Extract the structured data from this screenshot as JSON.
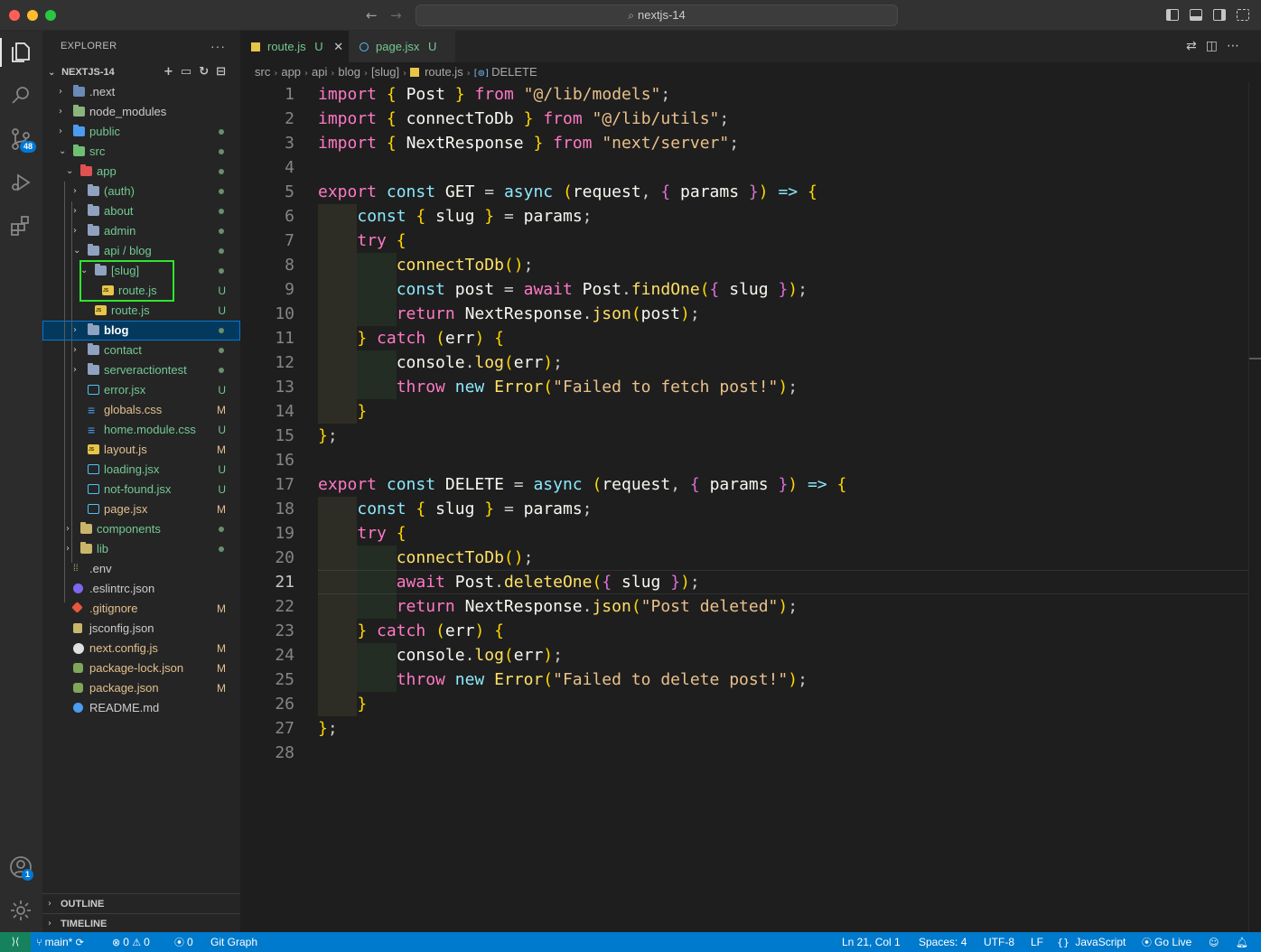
{
  "window": {
    "search_text": "nextjs-14"
  },
  "sidebar": {
    "title": "EXPLORER",
    "more": "···",
    "project": "NEXTJS-14",
    "tree": [
      {
        "name": ".next",
        "type": "folder",
        "depth": 0,
        "chevron": "right",
        "status": "",
        "icon_color": "#6a8bb5"
      },
      {
        "name": "node_modules",
        "type": "folder",
        "depth": 0,
        "chevron": "right",
        "status": "",
        "icon_color": "#8bb57a"
      },
      {
        "name": "public",
        "type": "folder",
        "depth": 0,
        "chevron": "right",
        "status": "dot",
        "icon_color": "#4a9df0"
      },
      {
        "name": "src",
        "type": "folder",
        "depth": 0,
        "chevron": "down",
        "status": "dot",
        "icon_color": "#6fbf73"
      },
      {
        "name": "app",
        "type": "folder",
        "depth": 1,
        "chevron": "down",
        "status": "dot",
        "icon_color": "#e05252"
      },
      {
        "name": "(auth)",
        "type": "folder",
        "depth": 2,
        "chevron": "right",
        "status": "dot",
        "icon_color": "#8fa3c0"
      },
      {
        "name": "about",
        "type": "folder",
        "depth": 2,
        "chevron": "right",
        "status": "dot",
        "icon_color": "#8fa3c0"
      },
      {
        "name": "admin",
        "type": "folder",
        "depth": 2,
        "chevron": "right",
        "status": "dot",
        "icon_color": "#8fa3c0"
      },
      {
        "name": "api / blog",
        "type": "folder",
        "depth": 2,
        "chevron": "down",
        "status": "dot",
        "icon_color": "#8fa3c0"
      },
      {
        "name": "[slug]",
        "type": "folder",
        "depth": 3,
        "chevron": "down",
        "status": "dot",
        "icon_color": "#8fa3c0"
      },
      {
        "name": "route.js",
        "type": "js",
        "depth": 4,
        "chevron": "",
        "status": "U"
      },
      {
        "name": "route.js",
        "type": "js",
        "depth": 3,
        "chevron": "",
        "status": "U"
      },
      {
        "name": "blog",
        "type": "folder",
        "depth": 2,
        "chevron": "right",
        "status": "dot",
        "selected": true,
        "icon_color": "#8fa3c0"
      },
      {
        "name": "contact",
        "type": "folder",
        "depth": 2,
        "chevron": "right",
        "status": "dot",
        "icon_color": "#8fa3c0"
      },
      {
        "name": "serveractiontest",
        "type": "folder",
        "depth": 2,
        "chevron": "right",
        "status": "dot",
        "icon_color": "#8fa3c0"
      },
      {
        "name": "error.jsx",
        "type": "react",
        "depth": 2,
        "chevron": "",
        "status": "U"
      },
      {
        "name": "globals.css",
        "type": "css",
        "depth": 2,
        "chevron": "",
        "status": "M"
      },
      {
        "name": "home.module.css",
        "type": "css",
        "depth": 2,
        "chevron": "",
        "status": "U"
      },
      {
        "name": "layout.js",
        "type": "js",
        "depth": 2,
        "chevron": "",
        "status": "M"
      },
      {
        "name": "loading.jsx",
        "type": "react",
        "depth": 2,
        "chevron": "",
        "status": "U"
      },
      {
        "name": "not-found.jsx",
        "type": "react",
        "depth": 2,
        "chevron": "",
        "status": "U"
      },
      {
        "name": "page.jsx",
        "type": "react",
        "depth": 2,
        "chevron": "",
        "status": "M"
      },
      {
        "name": "components",
        "type": "folder",
        "depth": 1,
        "chevron": "right",
        "status": "dot",
        "icon_color": "#c9b66a"
      },
      {
        "name": "lib",
        "type": "folder",
        "depth": 1,
        "chevron": "right",
        "status": "dot",
        "icon_color": "#c9b66a"
      },
      {
        "name": ".env",
        "type": "env",
        "depth": 0,
        "chevron": "",
        "status": ""
      },
      {
        "name": ".eslintrc.json",
        "type": "eslint",
        "depth": 0,
        "chevron": "",
        "status": ""
      },
      {
        "name": ".gitignore",
        "type": "git",
        "depth": 0,
        "chevron": "",
        "status": "M"
      },
      {
        "name": "jsconfig.json",
        "type": "json",
        "depth": 0,
        "chevron": "",
        "status": ""
      },
      {
        "name": "next.config.js",
        "type": "next",
        "depth": 0,
        "chevron": "",
        "status": "M"
      },
      {
        "name": "package-lock.json",
        "type": "pkg",
        "depth": 0,
        "chevron": "",
        "status": "M"
      },
      {
        "name": "package.json",
        "type": "pkg",
        "depth": 0,
        "chevron": "",
        "status": "M"
      },
      {
        "name": "README.md",
        "type": "info",
        "depth": 0,
        "chevron": "",
        "status": ""
      }
    ],
    "outline": "OUTLINE",
    "timeline": "TIMELINE"
  },
  "activity": {
    "scm_badge": "48",
    "account_badge": "1"
  },
  "tabs": [
    {
      "label": "route.js",
      "status": "U",
      "active": true
    },
    {
      "label": "page.jsx",
      "status": "U",
      "active": false
    }
  ],
  "breadcrumb": [
    "src",
    "app",
    "api",
    "blog",
    "[slug]",
    "route.js",
    "DELETE"
  ],
  "editor": {
    "current_line": 21,
    "lines": [
      "import { Post } from \"@/lib/models\";",
      "import { connectToDb } from \"@/lib/utils\";",
      "import { NextResponse } from \"next/server\";",
      "",
      "export const GET = async (request, { params }) => {",
      "  const { slug } = params;",
      "  try {",
      "    connectToDb();",
      "    const post = await Post.findOne({ slug });",
      "    return NextResponse.json(post);",
      "  } catch (err) {",
      "    console.log(err);",
      "    throw new Error(\"Failed to fetch post!\");",
      "  }",
      "};",
      "",
      "export const DELETE = async (request, { params }) => {",
      "  const { slug } = params;",
      "  try {",
      "    connectToDb();",
      "    await Post.deleteOne({ slug });",
      "    return NextResponse.json(\"Post deleted\");",
      "  } catch (err) {",
      "    console.log(err);",
      "    throw new Error(\"Failed to delete post!\");",
      "  }",
      "};",
      ""
    ]
  },
  "statusbar": {
    "branch": "main*",
    "errors": "0",
    "warnings": "0",
    "ports": "0",
    "git_graph": "Git Graph",
    "position": "Ln 21, Col 1",
    "spaces": "Spaces: 4",
    "encoding": "UTF-8",
    "eol": "LF",
    "language": "JavaScript",
    "golive": "Go Live"
  }
}
